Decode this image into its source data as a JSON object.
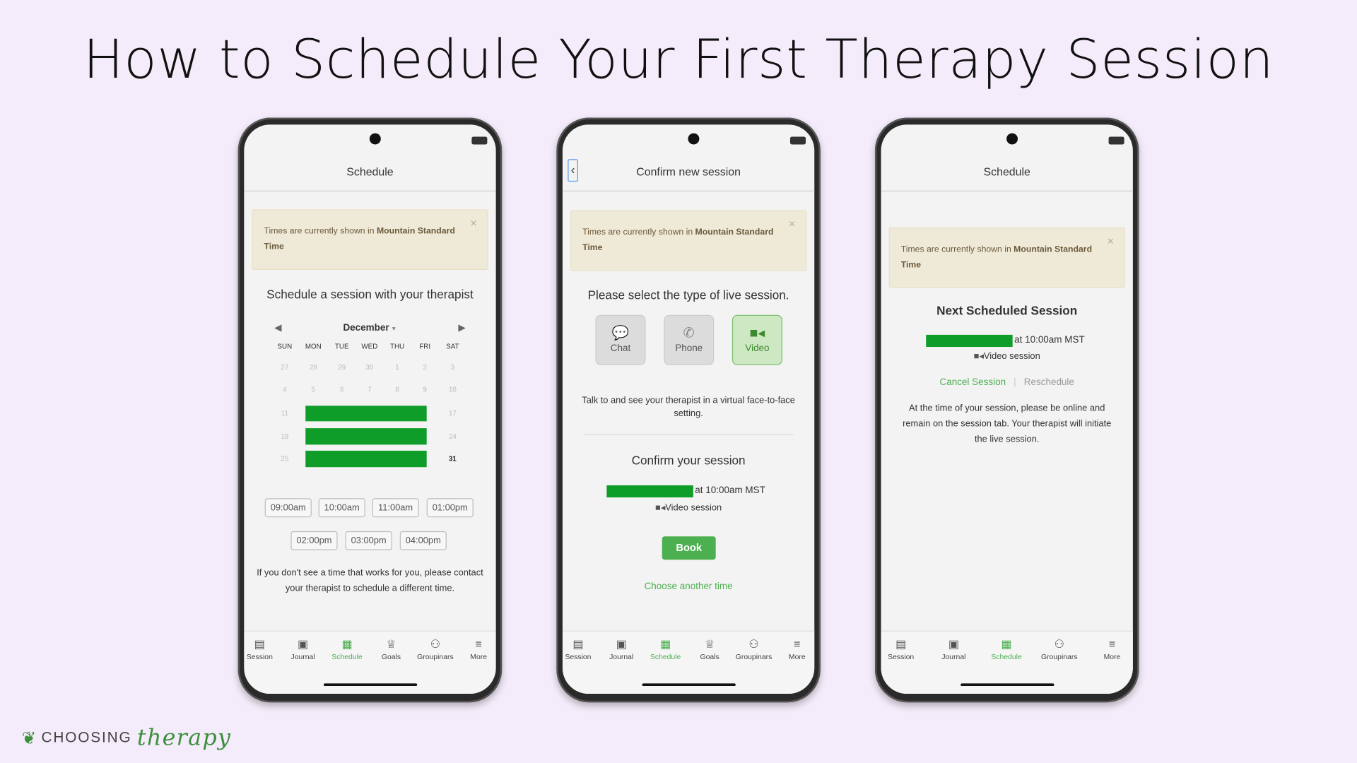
{
  "title": "How to Schedule Your First Therapy Session",
  "colors": {
    "accent": "#4caf50",
    "redaction": "#0f9d2a",
    "background": "#f4ecfa"
  },
  "notice": {
    "prefix": "Times are currently shown in ",
    "bold": "Mountain Standard Time",
    "close": "×"
  },
  "phone1": {
    "header": "Schedule",
    "heading": "Schedule a session with your therapist",
    "month": "December",
    "days": [
      "SUN",
      "MON",
      "TUE",
      "WED",
      "THU",
      "FRI",
      "SAT"
    ],
    "weeks": [
      [
        "27",
        "28",
        "29",
        "30",
        "1",
        "2",
        "3"
      ],
      [
        "4",
        "5",
        "6",
        "7",
        "8",
        "9",
        "10"
      ],
      [
        "11",
        "",
        "",
        "",
        "",
        "",
        "17"
      ],
      [
        "18",
        "",
        "",
        "",
        "",
        "",
        "24"
      ],
      [
        "25",
        "",
        "",
        "",
        "",
        "",
        "31"
      ]
    ],
    "times": [
      "09:00am",
      "10:00am",
      "11:00am",
      "01:00pm",
      "02:00pm",
      "03:00pm",
      "04:00pm"
    ],
    "footer": "If you don't see a time that works for you, please contact your therapist to schedule a different time."
  },
  "phone2": {
    "header": "Confirm new session",
    "heading": "Please select the type of live session.",
    "types": [
      {
        "label": "Chat",
        "icon": "chat-icon"
      },
      {
        "label": "Phone",
        "icon": "phone-icon"
      },
      {
        "label": "Video",
        "icon": "video-icon",
        "selected": true
      }
    ],
    "description": "Talk to and see your therapist in a virtual face-to-face setting.",
    "confirm_heading": "Confirm your session",
    "time": "at 10:00am MST",
    "session_type": "Video session",
    "book": "Book",
    "another": "Choose another time"
  },
  "phone3": {
    "header": "Schedule",
    "heading": "Next Scheduled Session",
    "time": "at 10:00am MST",
    "session_type": "Video session",
    "cancel": "Cancel Session",
    "reschedule": "Reschedule",
    "info": "At the time of your session, please be online and remain on the session tab. Your therapist will initiate the live session."
  },
  "nav_full": [
    {
      "label": "Session",
      "icon": "session-icon"
    },
    {
      "label": "Journal",
      "icon": "journal-icon"
    },
    {
      "label": "Schedule",
      "icon": "calendar-icon",
      "active": true
    },
    {
      "label": "Goals",
      "icon": "trophy-icon"
    },
    {
      "label": "Groupinars",
      "icon": "group-icon"
    },
    {
      "label": "More",
      "icon": "menu-icon"
    }
  ],
  "nav_short": [
    {
      "label": "Session",
      "icon": "session-icon"
    },
    {
      "label": "Journal",
      "icon": "journal-icon"
    },
    {
      "label": "Schedule",
      "icon": "calendar-icon",
      "active": true
    },
    {
      "label": "Groupinars",
      "icon": "group-icon"
    },
    {
      "label": "More",
      "icon": "menu-icon"
    }
  ],
  "logo": {
    "word": "CHOOSING",
    "script": "therapy"
  }
}
